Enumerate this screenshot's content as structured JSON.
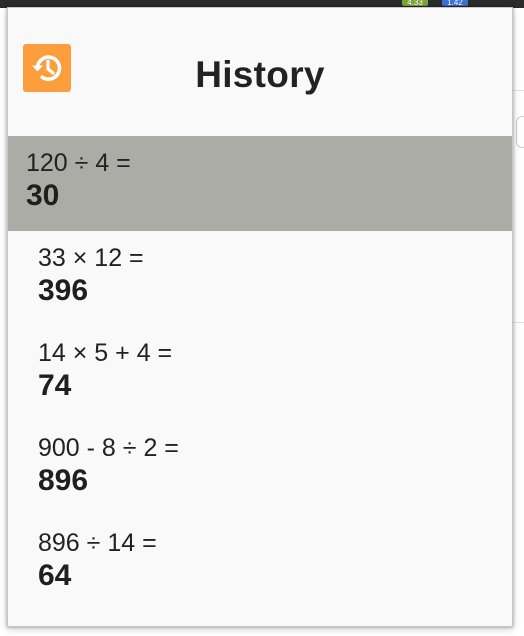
{
  "background": {
    "badges": [
      "4.33",
      "1.42"
    ]
  },
  "popup": {
    "title": "History",
    "icon": "history-icon",
    "accent_color": "#fb9e3b",
    "selected_color": "#acaca6",
    "items": [
      {
        "expression": "120 ÷ 4 =",
        "result": "30",
        "selected": true
      },
      {
        "expression": "33 × 12 =",
        "result": "396",
        "selected": false
      },
      {
        "expression": "14 × 5 + 4 =",
        "result": "74",
        "selected": false
      },
      {
        "expression": "900 - 8 ÷ 2 =",
        "result": "896",
        "selected": false
      },
      {
        "expression": "896 ÷ 14 =",
        "result": "64",
        "selected": false
      }
    ]
  }
}
